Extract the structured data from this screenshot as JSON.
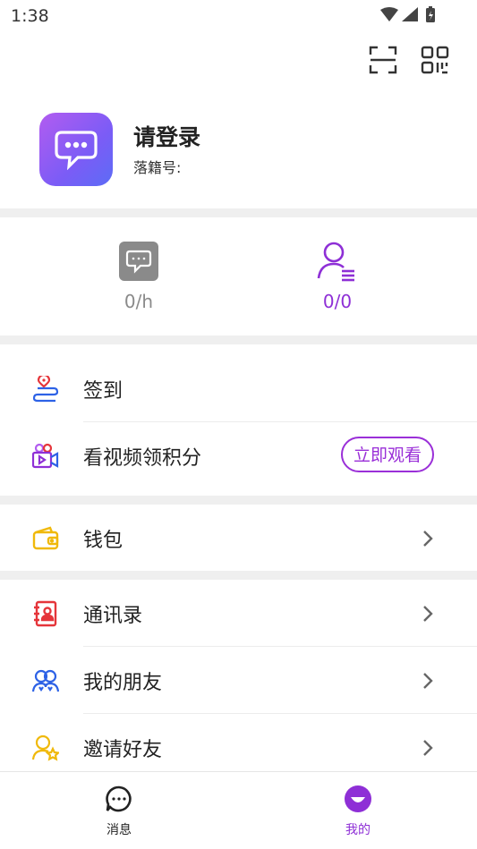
{
  "status_bar": {
    "time": "1:38"
  },
  "profile": {
    "name": "请登录",
    "id_label": "落籍号:"
  },
  "stats": [
    {
      "icon": "chat-square-icon",
      "value": "0/h",
      "color": "#8a8a8a"
    },
    {
      "icon": "user-list-icon",
      "value": "0/0",
      "color": "#8e2fd6"
    }
  ],
  "menu": {
    "checkin": "签到",
    "watch_video": "看视频领积分",
    "watch_button": "立即观看",
    "wallet": "钱包",
    "contacts": "通讯录",
    "friends": "我的朋友",
    "invite": "邀请好友"
  },
  "tabs": {
    "messages": "消息",
    "mine": "我的"
  },
  "colors": {
    "accent": "#9a2fd8",
    "blue": "#2d62e6",
    "yellow": "#f0b90b",
    "red": "#e5353a"
  }
}
